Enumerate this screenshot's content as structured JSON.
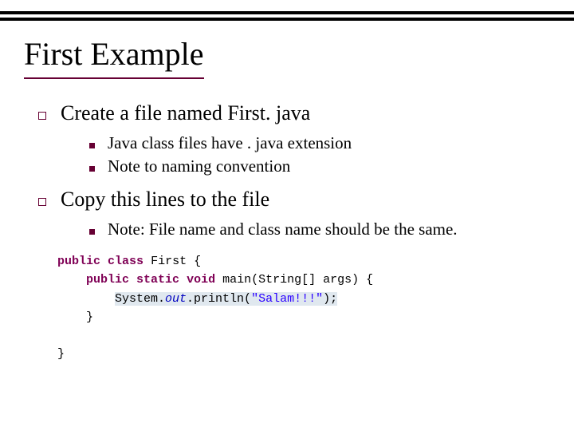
{
  "title": "First Example",
  "bullets": [
    {
      "text": "Create a file named First. java",
      "children": [
        "Java class files have . java extension",
        "Note to naming convention"
      ]
    },
    {
      "text": "Copy this lines to the file",
      "children": [
        "Note: File name and class name should be the same."
      ]
    }
  ],
  "code": {
    "kw_public": "public",
    "kw_class": "class",
    "cls_name": "First",
    "brace_open": "{",
    "kw_static": "static",
    "kw_void": "void",
    "main": "main",
    "params": "(String[] args)",
    "sys": "System.",
    "out": "out",
    "dot_println": ".println(",
    "str": "\"Salam!!!\"",
    "close_paren": ");",
    "brace_close": "}"
  }
}
